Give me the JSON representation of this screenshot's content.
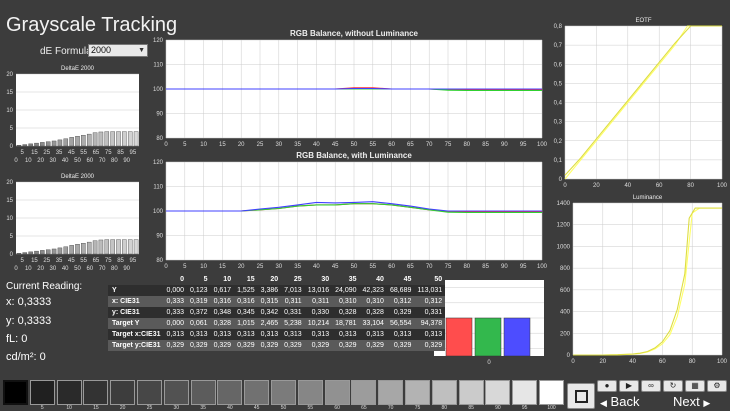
{
  "title": "Grayscale Tracking",
  "formula": {
    "label": "dE Formula:",
    "value": "2000"
  },
  "charts": {
    "deltae_top": {
      "title": "DeltaE 2000",
      "yticks": [
        "0",
        "5",
        "10",
        "15",
        "20"
      ],
      "ymax": 20,
      "xticks": [
        "5",
        "15",
        "25",
        "35",
        "45",
        "55",
        "65",
        "75",
        "85",
        "95"
      ],
      "xlabels_row2": [
        "0",
        "10",
        "20",
        "30",
        "40",
        "50",
        "60",
        "70",
        "80",
        "90"
      ],
      "values": [
        0.2,
        0.4,
        0.6,
        0.8,
        1.0,
        1.2,
        1.4,
        1.7,
        2.0,
        2.4,
        2.7,
        3.0,
        3.3,
        3.7,
        3.9,
        4.0,
        4.0,
        4.0,
        4.0,
        4.0,
        4.0
      ],
      "chart_type": "bar"
    },
    "deltae_bottom": {
      "title": "DeltaE 2000",
      "yticks": [
        "0",
        "5",
        "10",
        "15",
        "20"
      ],
      "ymax": 20,
      "xticks": [
        "5",
        "15",
        "25",
        "35",
        "45",
        "55",
        "65",
        "75",
        "85",
        "95"
      ],
      "xlabels_row2": [
        "0",
        "10",
        "20",
        "30",
        "40",
        "50",
        "60",
        "70",
        "80",
        "90"
      ],
      "values": [
        0.2,
        0.4,
        0.6,
        0.8,
        1.0,
        1.2,
        1.4,
        1.7,
        2.0,
        2.4,
        2.7,
        3.0,
        3.3,
        3.7,
        3.9,
        4.0,
        4.0,
        4.0,
        4.0,
        4.0,
        4.0
      ],
      "chart_type": "bar"
    },
    "rgb_no_lum": {
      "title": "RGB Balance, without Luminance",
      "yticks": [
        "80",
        "90",
        "100",
        "110",
        "120"
      ],
      "ylim": [
        80,
        120
      ],
      "xticks": [
        "0",
        "5",
        "10",
        "15",
        "20",
        "25",
        "30",
        "35",
        "40",
        "45",
        "50",
        "55",
        "60",
        "65",
        "70",
        "75",
        "80",
        "85",
        "90",
        "95",
        "100"
      ],
      "x": [
        0,
        5,
        10,
        15,
        20,
        25,
        30,
        35,
        40,
        45,
        50,
        55,
        60,
        65,
        70,
        75,
        80,
        85,
        90,
        95,
        100
      ],
      "series": [
        {
          "color": "#ff3030",
          "values": [
            100,
            100,
            100,
            100,
            100,
            100,
            100,
            100,
            100,
            100,
            100.5,
            100.5,
            100,
            100,
            100,
            99.7,
            99.6,
            99.6,
            99.6,
            99.6,
            99.6
          ]
        },
        {
          "color": "#30d030",
          "values": [
            100,
            100,
            100,
            100,
            100,
            100,
            100,
            100,
            100,
            100,
            100,
            100,
            100,
            100,
            100,
            99.5,
            99.4,
            99.4,
            99.4,
            99.4,
            99.4
          ]
        },
        {
          "color": "#4040ff",
          "values": [
            100,
            100,
            100,
            100,
            100,
            100,
            100,
            100,
            100,
            100,
            100.2,
            100.2,
            100,
            100,
            100,
            100,
            100,
            100,
            100,
            100,
            100
          ]
        }
      ]
    },
    "rgb_with_lum": {
      "title": "RGB Balance, with Luminance",
      "yticks": [
        "80",
        "90",
        "100",
        "110",
        "120"
      ],
      "ylim": [
        80,
        120
      ],
      "xticks": [
        "0",
        "5",
        "10",
        "15",
        "20",
        "25",
        "30",
        "35",
        "40",
        "45",
        "50",
        "55",
        "60",
        "65",
        "70",
        "75",
        "80",
        "85",
        "90",
        "95",
        "100"
      ],
      "x": [
        0,
        5,
        10,
        15,
        20,
        25,
        30,
        35,
        40,
        45,
        50,
        55,
        60,
        65,
        70,
        75,
        80,
        85,
        90,
        95,
        100
      ],
      "series": [
        {
          "color": "#ff3030",
          "values": [
            100,
            100,
            100,
            100,
            100,
            100.5,
            101,
            102,
            102.5,
            102.5,
            103,
            103,
            102.5,
            101.5,
            100.5,
            99.8,
            99.6,
            99.6,
            99.6,
            99.6,
            99.6
          ]
        },
        {
          "color": "#30d030",
          "values": [
            100,
            100,
            100,
            100,
            100,
            100.5,
            101,
            102,
            102.5,
            102.5,
            103,
            103,
            102.5,
            101.5,
            100.5,
            99.5,
            99.4,
            99.4,
            99.4,
            99.4,
            99.4
          ]
        },
        {
          "color": "#4040ff",
          "values": [
            100,
            100,
            100,
            100,
            100,
            100.8,
            101.5,
            102.5,
            103.5,
            103.3,
            103.5,
            103.8,
            103,
            102,
            100.8,
            100,
            100,
            100,
            100,
            100,
            100
          ]
        }
      ]
    },
    "eotf": {
      "title": "EOTF",
      "yticks": [
        "0",
        "0,1",
        "0,2",
        "0,3",
        "0,4",
        "0,5",
        "0,6",
        "0,7",
        "0,8"
      ],
      "ylim": [
        0,
        0.8
      ],
      "xticks": [
        "0",
        "20",
        "40",
        "60",
        "80",
        "100"
      ],
      "xlim": [
        0,
        100
      ],
      "series": [
        {
          "color": "#ffff66",
          "x": [
            0,
            10,
            20,
            30,
            40,
            50,
            60,
            70,
            78,
            80,
            100
          ],
          "values": [
            0,
            0.1,
            0.2,
            0.3,
            0.4,
            0.5,
            0.6,
            0.7,
            0.8,
            0.8,
            0.8
          ]
        },
        {
          "color": "#dddd44",
          "x": [
            0,
            10,
            20,
            30,
            40,
            50,
            60,
            70,
            80,
            100
          ],
          "values": [
            0.02,
            0.11,
            0.21,
            0.31,
            0.41,
            0.51,
            0.61,
            0.71,
            0.8,
            0.8
          ]
        }
      ]
    },
    "luminance": {
      "title": "Luminance",
      "yticks": [
        "0",
        "200",
        "400",
        "600",
        "800",
        "1000",
        "1200",
        "1400"
      ],
      "ylim": [
        0,
        1500
      ],
      "xticks": [
        "0",
        "20",
        "40",
        "60",
        "80",
        "100"
      ],
      "xlim": [
        0,
        100
      ],
      "series": [
        {
          "color": "#ffff66",
          "x": [
            0,
            10,
            20,
            30,
            40,
            45,
            50,
            55,
            60,
            65,
            70,
            75,
            80,
            85,
            100
          ],
          "values": [
            0,
            0,
            0,
            2,
            8,
            15,
            30,
            60,
            110,
            200,
            380,
            700,
            1400,
            1450,
            1450
          ]
        },
        {
          "color": "#dddd44",
          "x": [
            0,
            10,
            20,
            30,
            40,
            45,
            50,
            55,
            60,
            65,
            70,
            75,
            78,
            82,
            100
          ],
          "values": [
            0,
            0,
            0,
            3,
            10,
            18,
            35,
            70,
            130,
            240,
            450,
            800,
            1350,
            1450,
            1450
          ]
        }
      ]
    },
    "current_patch": {
      "yticks": [
        "96",
        "98",
        "100",
        "102",
        "104"
      ],
      "ylim": [
        95,
        105
      ],
      "xtick": "0",
      "bars": [
        {
          "color": "#ff4d4d",
          "value": 100
        },
        {
          "color": "#33b84d",
          "value": 100
        },
        {
          "color": "#4d4dff",
          "value": 100
        }
      ]
    }
  },
  "current_reading": {
    "heading": "Current Reading:",
    "x": "x: 0,3333",
    "y": "y: 0,3333",
    "fl": "fL: 0",
    "cdm2": "cd/m²: 0"
  },
  "table": {
    "columns": [
      "0",
      "5",
      "10",
      "15",
      "20",
      "25",
      "30",
      "35",
      "40",
      "45",
      "50"
    ],
    "rows": [
      {
        "label": "Y",
        "values": [
          "0,000",
          "0,123",
          "0,617",
          "1,525",
          "3,386",
          "7,013",
          "13,016",
          "24,090",
          "42,323",
          "68,689",
          "113,031"
        ]
      },
      {
        "label": "x: CIE31",
        "values": [
          "0,333",
          "0,319",
          "0,316",
          "0,316",
          "0,315",
          "0,311",
          "0,311",
          "0,310",
          "0,310",
          "0,312",
          "0,312"
        ]
      },
      {
        "label": "y: CIE31",
        "values": [
          "0,333",
          "0,372",
          "0,348",
          "0,345",
          "0,342",
          "0,331",
          "0,330",
          "0,328",
          "0,328",
          "0,329",
          "0,331"
        ]
      },
      {
        "label": "Target Y",
        "values": [
          "0,000",
          "0,061",
          "0,328",
          "1,015",
          "2,465",
          "5,238",
          "10,214",
          "18,781",
          "33,104",
          "56,554",
          "94,378"
        ]
      },
      {
        "label": "Target x:CIE31",
        "values": [
          "0,313",
          "0,313",
          "0,313",
          "0,313",
          "0,313",
          "0,313",
          "0,313",
          "0,313",
          "0,313",
          "0,313",
          "0,313"
        ]
      },
      {
        "label": "Target y:CIE31",
        "values": [
          "0,329",
          "0,329",
          "0,329",
          "0,329",
          "0,329",
          "0,329",
          "0,329",
          "0,329",
          "0,329",
          "0,329",
          "0,329"
        ]
      }
    ]
  },
  "patches": [
    {
      "label": "",
      "color": "#000000"
    },
    {
      "label": "5",
      "color": "#202020"
    },
    {
      "label": "10",
      "color": "#2a2a2a"
    },
    {
      "label": "15",
      "color": "#333333"
    },
    {
      "label": "20",
      "color": "#3d3d3d"
    },
    {
      "label": "25",
      "color": "#474747"
    },
    {
      "label": "30",
      "color": "#525252"
    },
    {
      "label": "35",
      "color": "#5c5c5c"
    },
    {
      "label": "40",
      "color": "#666666"
    },
    {
      "label": "45",
      "color": "#717171"
    },
    {
      "label": "50",
      "color": "#7b7b7b"
    },
    {
      "label": "55",
      "color": "#868686"
    },
    {
      "label": "60",
      "color": "#919191"
    },
    {
      "label": "65",
      "color": "#9c9c9c"
    },
    {
      "label": "70",
      "color": "#a7a7a7"
    },
    {
      "label": "75",
      "color": "#b3b3b3"
    },
    {
      "label": "80",
      "color": "#bfbfbf"
    },
    {
      "label": "85",
      "color": "#cbcbcb"
    },
    {
      "label": "90",
      "color": "#d8d8d8"
    },
    {
      "label": "95",
      "color": "#e6e6e6"
    },
    {
      "label": "100",
      "color": "#ffffff"
    }
  ],
  "nav": {
    "back": "Back",
    "next": "Next"
  },
  "controls": {
    "icons": [
      "record-icon",
      "stop-icon",
      "play-icon",
      "loop-icon",
      "refresh-icon",
      "settings-icon"
    ]
  }
}
